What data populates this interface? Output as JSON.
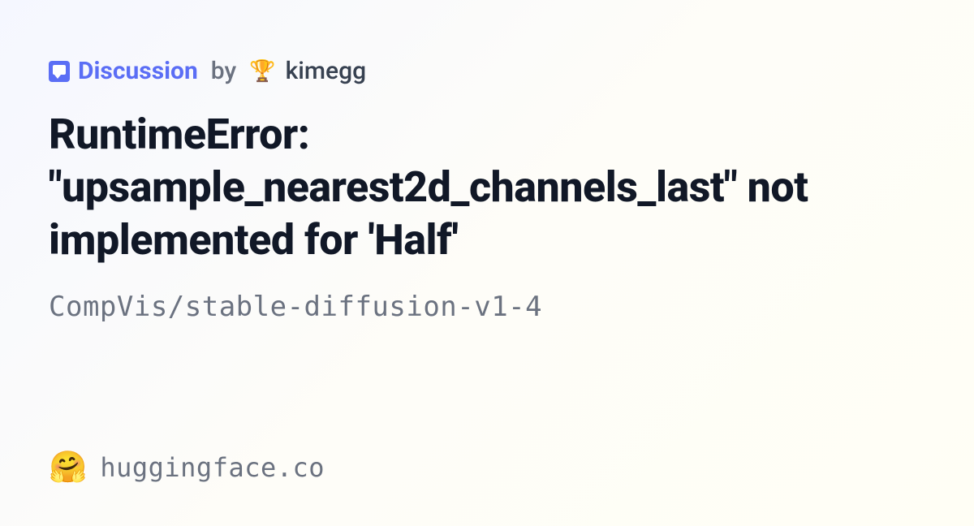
{
  "header": {
    "discussion_label": "Discussion",
    "by_label": "by",
    "trophy_icon": "🏆",
    "author": "kimegg"
  },
  "title": "RuntimeError: \"upsample_nearest2d_channels_last\" not implemented for 'Half'",
  "repo_path": "CompVis/stable-diffusion-v1-4",
  "footer": {
    "emoji": "🤗",
    "site": "huggingface.co"
  }
}
